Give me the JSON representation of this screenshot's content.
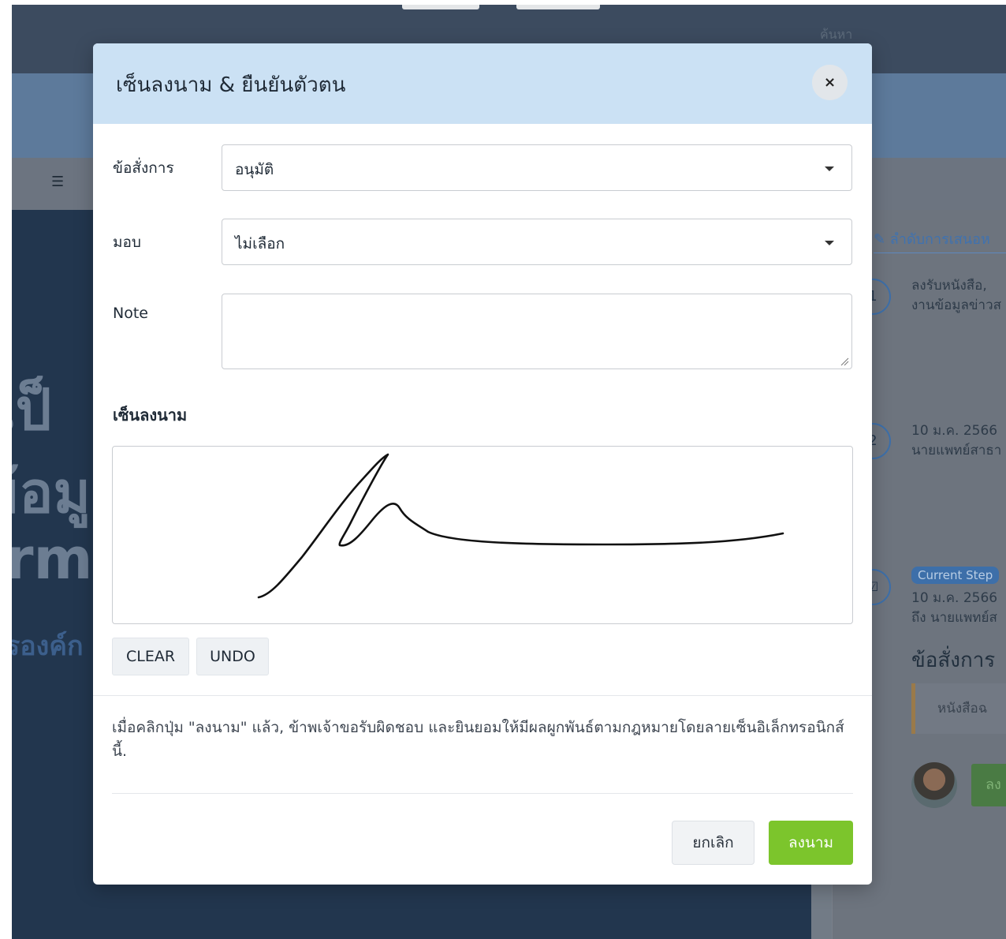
{
  "background": {
    "search_label": "ค้นหา",
    "hero_lines": [
      "เป็",
      "ข้อมู",
      "rm",
      "รองค์ก"
    ],
    "sidebar": {
      "title": "✎ ลำดับการเสนอห",
      "steps": [
        {
          "number": "1",
          "line1": "ลงรับหนังสือ,",
          "line2": "งานข้อมูลข่าวส"
        },
        {
          "number": "2",
          "line1": "10 ม.ค. 2566",
          "line2": "นายแพทย์สาธา"
        },
        {
          "number": "☑",
          "badge": "Current Step",
          "line1": "10 ม.ค. 2566",
          "line2": "ถึง นายแพทย์ส"
        }
      ],
      "heading": "ข้อสั่งการ",
      "quote": "หนังสือฉ",
      "green_button": "ลง"
    }
  },
  "modal": {
    "title": "เซ็นลงนาม & ยืนยันตัวตน",
    "close_symbol": "×",
    "fields": {
      "order": {
        "label": "ข้อสั่งการ",
        "value": "อนุมัติ"
      },
      "assign": {
        "label": "มอบ",
        "value": "ไม่เลือก"
      },
      "note": {
        "label": "Note",
        "value": ""
      }
    },
    "signature_heading": "เซ็นลงนาม",
    "clear_label": "CLEAR",
    "undo_label": "UNDO",
    "disclaimer": "เมื่อคลิกปุ่ม \"ลงนาม\" แล้ว, ข้าพเจ้าขอรับผิดชอบ และยินยอมให้มีผลผูกพันธ์ตามกฎหมายโดยลายเซ็นอิเล็กทรอนิกส์นี้.",
    "cancel_label": "ยกเลิก",
    "sign_label": "ลงนาม"
  },
  "colors": {
    "modal_header": "#cbe1f4",
    "sign_button": "#7cc52c",
    "hero_bg": "#22364e"
  }
}
